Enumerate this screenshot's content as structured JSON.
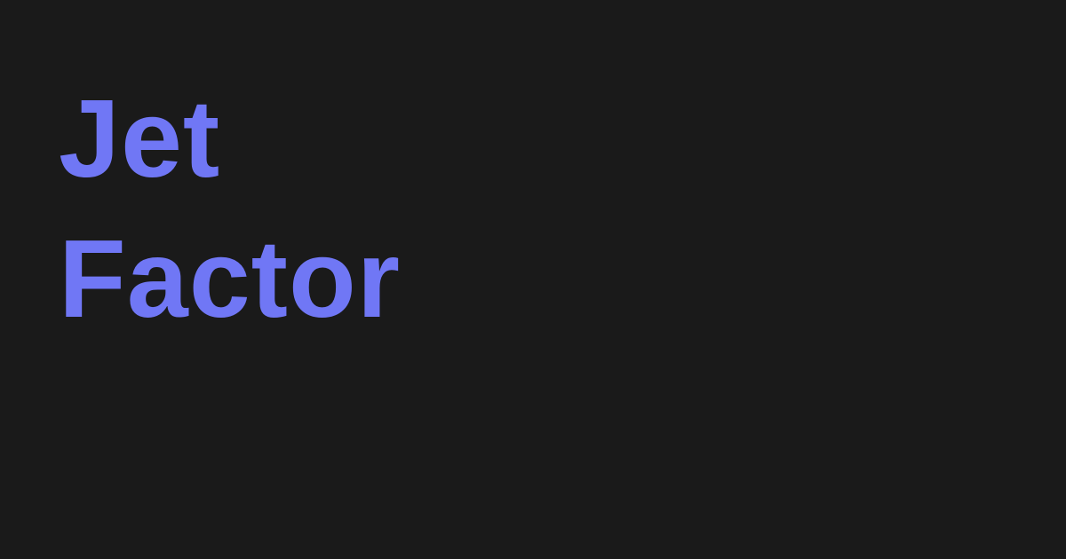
{
  "title": {
    "lines": [
      "Jet",
      "Factor"
    ]
  },
  "colors": {
    "background": "#1a1a1a",
    "title": "#7077f5"
  }
}
